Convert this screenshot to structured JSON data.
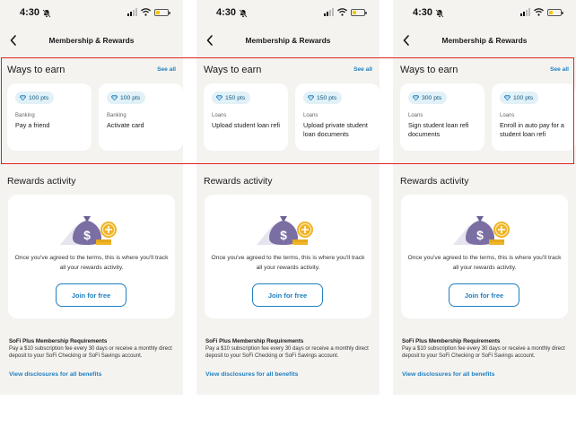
{
  "status_time": "4:30",
  "nav_title": "Membership & Rewards",
  "ways_to_earn": {
    "title": "Ways to earn",
    "see_all": "See all"
  },
  "screens": [
    {
      "cards": [
        {
          "points": "100 pts",
          "category": "Banking",
          "title": "Pay a friend"
        },
        {
          "points": "100 pts",
          "category": "Banking",
          "title": "Activate card"
        }
      ]
    },
    {
      "cards": [
        {
          "points": "150 pts",
          "category": "Loans",
          "title": "Upload student loan refi"
        },
        {
          "points": "150 pts",
          "category": "Loans",
          "title": "Upload private student loan documents"
        }
      ]
    },
    {
      "cards": [
        {
          "points": "300 pts",
          "category": "Loans",
          "title": "Sign student loan refi documents"
        },
        {
          "points": "100 pts",
          "category": "Loans",
          "title": "Enroll in auto pay for a student loan refi"
        }
      ]
    }
  ],
  "rewards_activity": {
    "title": "Rewards activity",
    "empty_message": "Once you've agreed to the terms, this is where you'll track all your rewards activity.",
    "join_button": "Join for free"
  },
  "plus_requirements": {
    "title": "SoFi Plus Membership Requirements",
    "description": "Pay a $10 subscription fee every 30 days or receive a monthly direct deposit to your SoFi Checking or SoFi Savings account."
  },
  "disclosures_link": "View disclosures for all benefits",
  "colors": {
    "link": "#1f7fbf",
    "badge_bg": "#e1f1f7",
    "highlight": "#e02424",
    "bag": "#7a6ea3",
    "coin": "#f0b429"
  }
}
